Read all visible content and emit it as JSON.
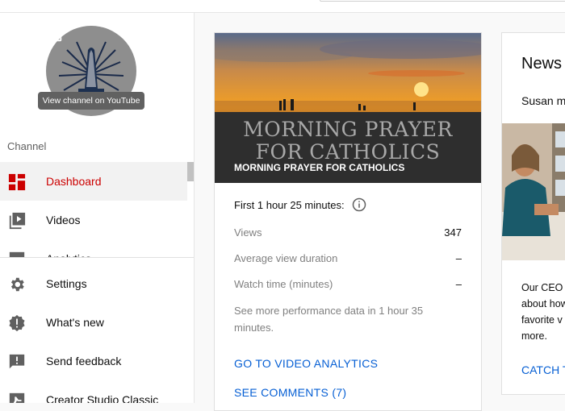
{
  "sidebar": {
    "tooltip": "View channel on YouTube",
    "section_label": "Channel",
    "items": [
      {
        "label": "Dashboard",
        "icon": "dashboard-icon",
        "active": true
      },
      {
        "label": "Videos",
        "icon": "videos-icon"
      },
      {
        "label": "Analytics",
        "icon": "analytics-icon"
      },
      {
        "label": "Settings",
        "icon": "gear-icon"
      },
      {
        "label": "What's new",
        "icon": "badge-alert-icon"
      },
      {
        "label": "Send feedback",
        "icon": "feedback-icon"
      },
      {
        "label": "Creator Studio Classic",
        "icon": "classic-studio-icon"
      }
    ]
  },
  "video_card": {
    "thumbnail_text": "MORNING PRAYER FOR CATHOLICS",
    "thumbnail_text_line1": "MORNING PRAYER",
    "thumbnail_text_line2": "FOR CATHOLICS",
    "title": "MORNING PRAYER FOR CATHOLICS",
    "period": "First 1 hour 25 minutes:",
    "metrics": [
      {
        "label": "Views",
        "value": "347"
      },
      {
        "label": "Average view duration",
        "value": "–"
      },
      {
        "label": "Watch time (minutes)",
        "value": "–"
      }
    ],
    "more_data": "See more performance data in 1 hour 35 minutes.",
    "analytics_link": "GO TO VIDEO ANALYTICS",
    "comments_link": "SEE COMMENTS (7)"
  },
  "news_card": {
    "title": "News",
    "subtitle": "Susan m",
    "body_lines": [
      "Our CEO",
      "about how",
      "favorite v",
      "more."
    ],
    "link": "CATCH T"
  },
  "colors": {
    "accent_red": "#cc0000",
    "link_blue": "#065fd4",
    "active_bg": "#f2f2f2"
  }
}
